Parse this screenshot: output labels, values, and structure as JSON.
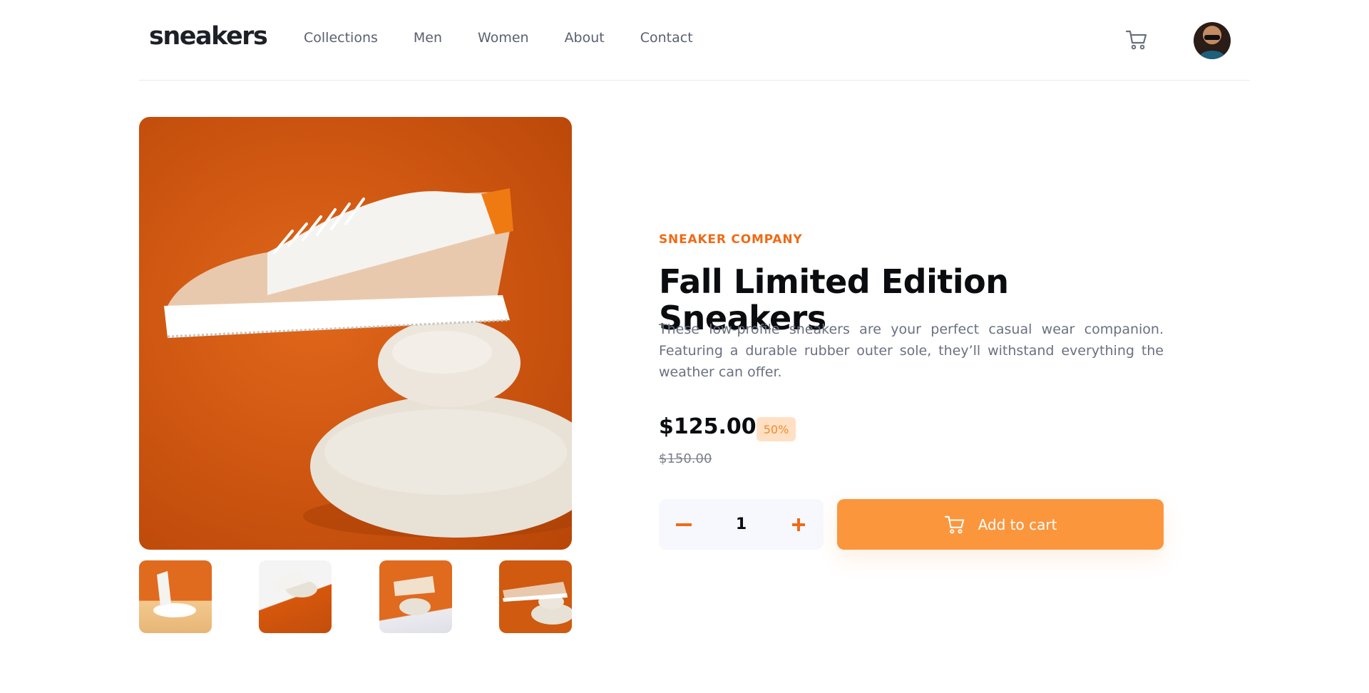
{
  "header": {
    "logo": "sneakers",
    "nav": [
      "Collections",
      "Men",
      "Women",
      "About",
      "Contact"
    ],
    "cart_icon": "cart-icon",
    "avatar": "user-avatar"
  },
  "gallery": {
    "main_image": "sneaker-on-stones-orange-background",
    "thumbnails": [
      "thumbnail-1",
      "thumbnail-2",
      "thumbnail-3",
      "thumbnail-4"
    ]
  },
  "product": {
    "company": "SNEAKER COMPANY",
    "title": "Fall Limited Edition Sneakers",
    "description": "These low-profile sneakers are your perfect casual wear companion. Featuring a durable rubber outer sole, they’ll withstand everything the weather can offer.",
    "price": "$125.00",
    "discount": "50%",
    "old_price": "$150.00",
    "quantity": "1",
    "add_to_cart_label": "Add to cart"
  },
  "colors": {
    "accent": "#ee6b16",
    "button": "#fb963d",
    "discount_bg": "#ffe0c4",
    "text_dark": "#0b0c0f",
    "text_muted": "#6a7080"
  }
}
